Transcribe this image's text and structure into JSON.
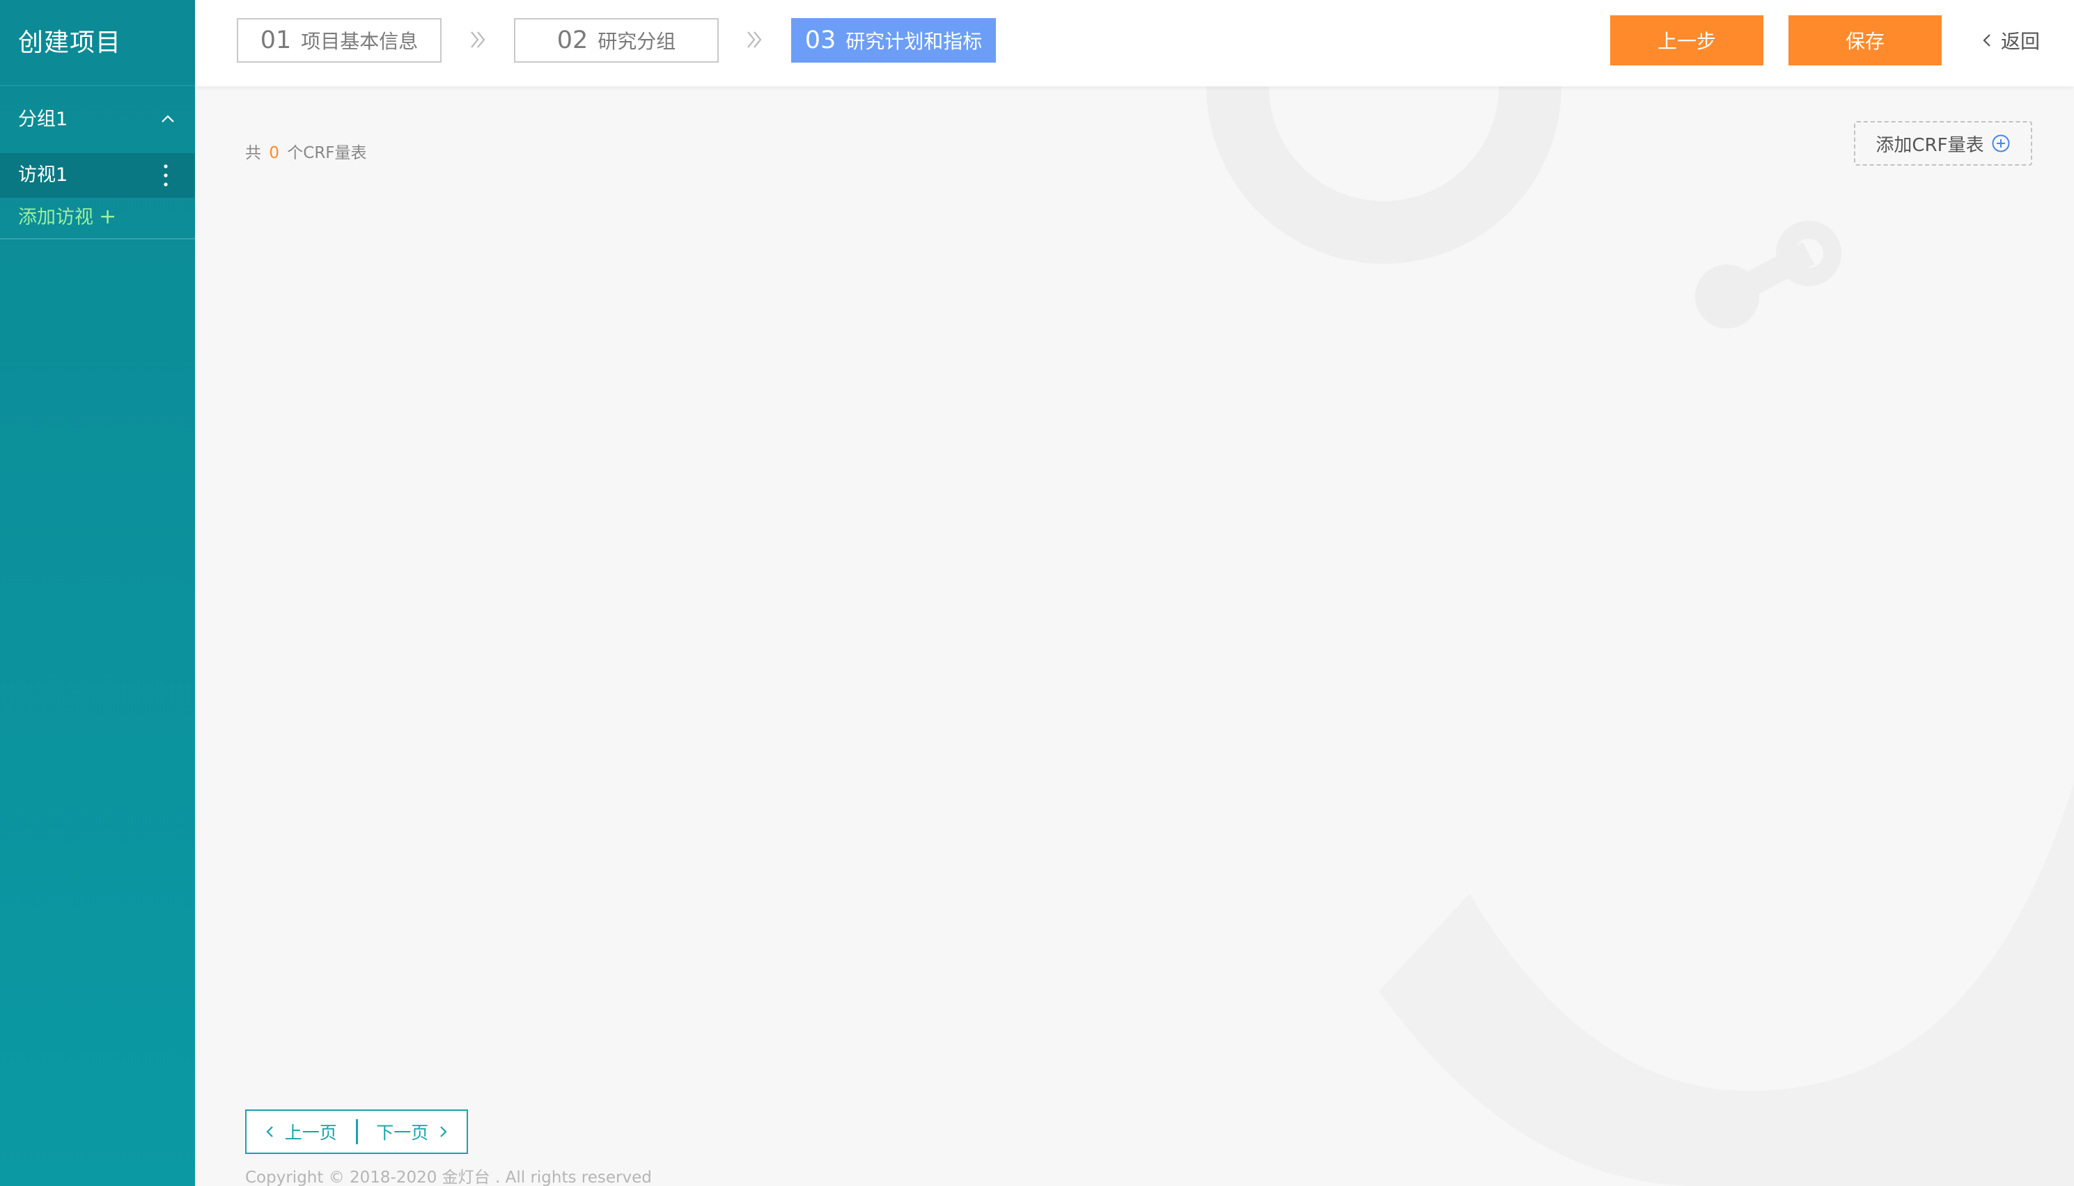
{
  "sidebar": {
    "title": "创建项目",
    "group_label": "分组1",
    "visit_label": "访视1",
    "add_visit_label": "添加访视",
    "add_visit_plus": "+"
  },
  "header": {
    "steps": [
      {
        "num": "01",
        "label": "项目基本信息"
      },
      {
        "num": "02",
        "label": "研究分组"
      },
      {
        "num": "03",
        "label": "研究计划和指标"
      }
    ],
    "active_step": 3,
    "prev_button": "上一步",
    "save_button": "保存",
    "back_label": "返回"
  },
  "main": {
    "count_prefix": "共",
    "count_value": "0",
    "count_suffix": "个CRF量表",
    "add_crf_label": "添加CRF量表",
    "pager": {
      "prev": "上一页",
      "next": "下一页"
    },
    "copyright": "Copyright © 2018-2020 金灯台 . All rights reserved"
  },
  "colors": {
    "sidebar": "#0c8a95",
    "active_step": "#6c9ef7",
    "orange": "#ff8a2b",
    "teal": "#19a3ad",
    "add_visit_text": "#9af0a0"
  },
  "icons": {
    "group_toggle": "chevron-up-icon",
    "visit_menu": "more-vertical-icon",
    "step_separator": "double-chevron-right-icon",
    "back": "chevron-left-icon",
    "add_crf": "plus-circle-icon",
    "pager_prev": "chevron-left-icon",
    "pager_next": "chevron-right-icon"
  }
}
